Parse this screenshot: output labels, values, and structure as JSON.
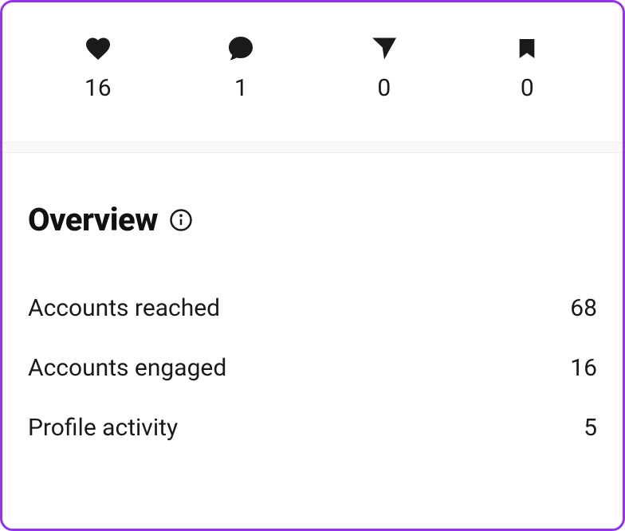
{
  "stats": {
    "likes": {
      "value": "16"
    },
    "comments": {
      "value": "1"
    },
    "shares": {
      "value": "0"
    },
    "saves": {
      "value": "0"
    }
  },
  "overview": {
    "title": "Overview",
    "metrics": [
      {
        "label": "Accounts reached",
        "value": "68"
      },
      {
        "label": "Accounts engaged",
        "value": "16"
      },
      {
        "label": "Profile activity",
        "value": "5"
      }
    ]
  }
}
